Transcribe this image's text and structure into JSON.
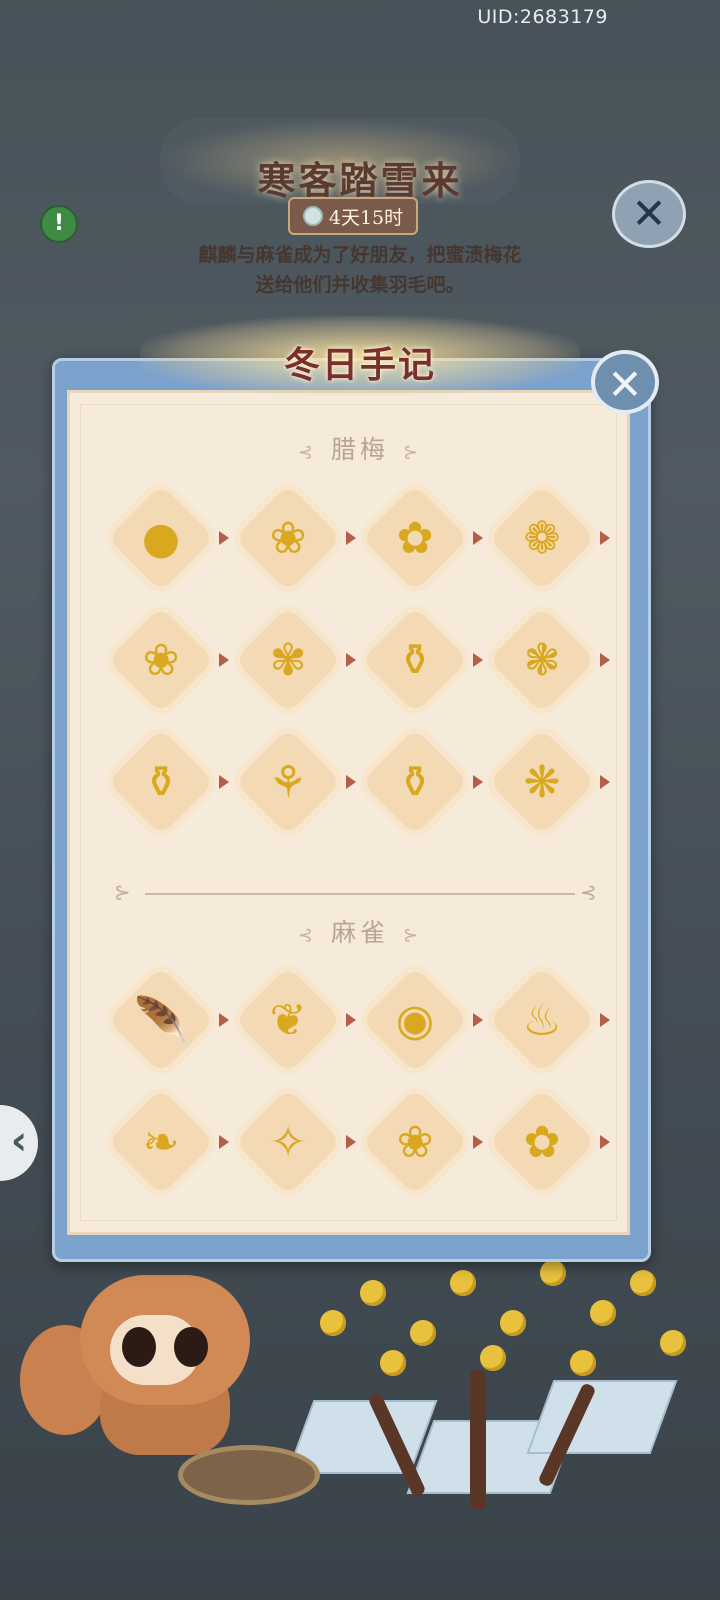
{
  "uid": "UID:2683179",
  "event": {
    "title": "寒客踏雪来",
    "timer": "4天15时",
    "description_line1": "麒麟与麻雀成为了好朋友，把蜜渍梅花",
    "description_line2": "送给他们并收集羽毛吧。"
  },
  "modal": {
    "title": "冬日手记",
    "section1_title": "腊梅",
    "section2_title": "麻雀"
  },
  "sections": [
    {
      "id": "wintersweet",
      "items": [
        {
          "icon": "wintersweet-bud-icon",
          "glyph": "●"
        },
        {
          "icon": "wintersweet-buds-icon",
          "glyph": "❀"
        },
        {
          "icon": "wintersweet-flower-icon",
          "glyph": "✿"
        },
        {
          "icon": "wintersweet-twig-icon",
          "glyph": "❁"
        },
        {
          "icon": "wintersweet-branch-icon",
          "glyph": "❀"
        },
        {
          "icon": "wintersweet-bunch-icon",
          "glyph": "✾"
        },
        {
          "icon": "black-vase-icon",
          "glyph": "⚱"
        },
        {
          "icon": "bonsai-pot-icon",
          "glyph": "❃"
        },
        {
          "icon": "flower-round-vase-icon",
          "glyph": "⚱"
        },
        {
          "icon": "lily-vase-icon",
          "glyph": "⚘"
        },
        {
          "icon": "striped-vase-icon",
          "glyph": "⚱"
        },
        {
          "icon": "grand-vase-icon",
          "glyph": "❋"
        }
      ]
    },
    {
      "id": "sparrow",
      "items": [
        {
          "icon": "feather-icon",
          "glyph": "🪶"
        },
        {
          "icon": "feathers-pair-icon",
          "glyph": "❦"
        },
        {
          "icon": "sparrow-resting-icon",
          "glyph": "◉"
        },
        {
          "icon": "sparrow-standing-icon",
          "glyph": "♨"
        },
        {
          "icon": "sparrow-flying-icon",
          "glyph": "❧"
        },
        {
          "icon": "sparrow-wings-open-icon",
          "glyph": "✧"
        },
        {
          "icon": "sparrow-on-branch-icon",
          "glyph": "❀"
        },
        {
          "icon": "sparrow-with-blossoms-icon",
          "glyph": "✿"
        }
      ]
    }
  ],
  "colors": {
    "accent": "#7a2f2a",
    "diamond": "#f3d9b4",
    "arrow": "#b55e4a",
    "frame": "#7ba2cc"
  }
}
